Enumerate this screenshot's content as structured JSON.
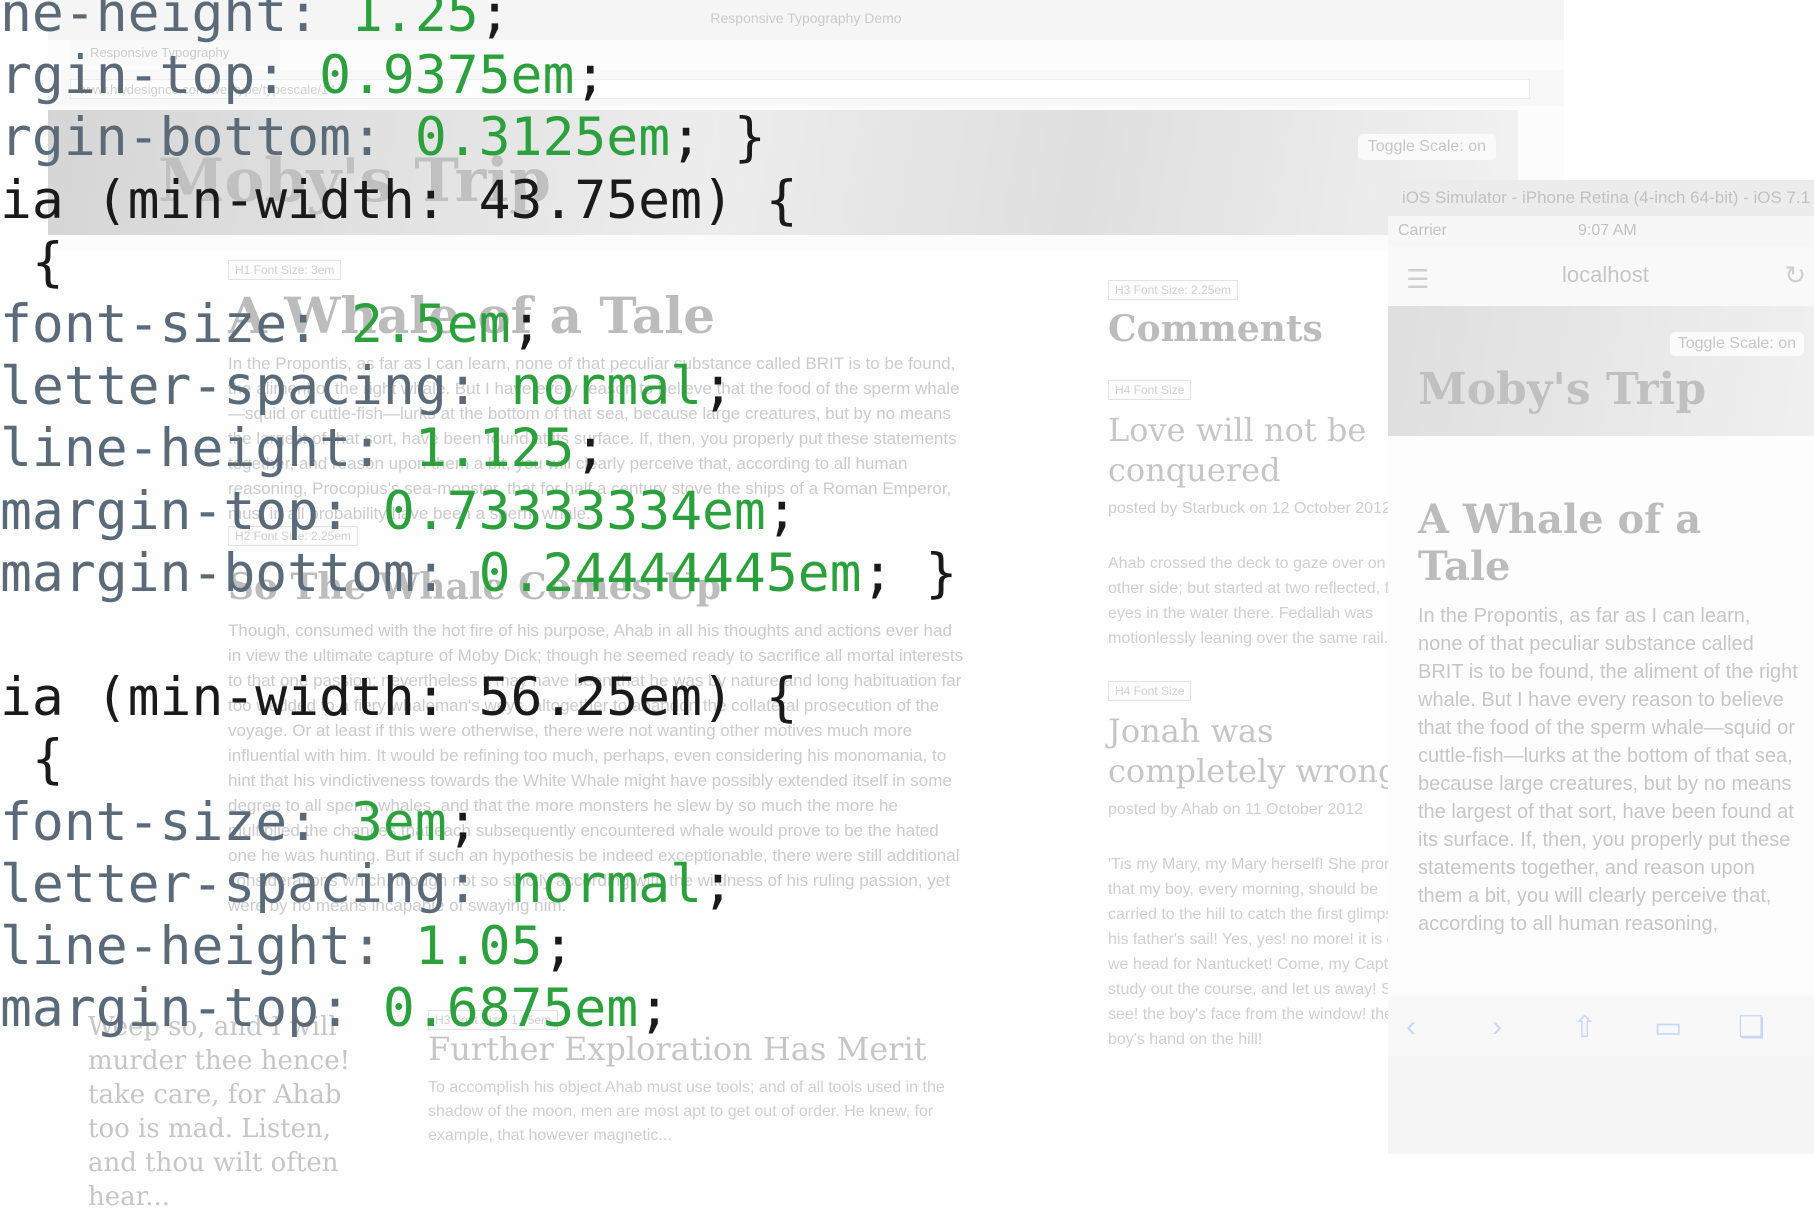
{
  "browser": {
    "window_title": "Responsive Typography Demo",
    "tab_label": "Responsive Typography",
    "url": "www.hwdesignco.com/webtype/typescale/14",
    "brand": "Moby's Trip",
    "toggle_label": "Toggle Scale: on"
  },
  "article": {
    "h1_badge": "H1 Font Size: 3em",
    "title": "A Whale of a Tale",
    "intro": "In the Propontis, as far as I can learn, none of that peculiar substance called BRIT is to be found, the aliment of the right whale. But I have every reason to believe that the food of the sperm whale—squid or cuttle-fish—lurks at the bottom of that sea, because large creatures, but by no means the largest of that sort, have been found at its surface. If, then, you properly put these statements together, and reason upon them a bit, you will clearly perceive that, according to all human reasoning, Procopius's sea-monster, that for half a century stove the ships of a Roman Emperor, must in all probability have been a sperm whale.",
    "h2_badge": "H2 Font Size: 2.25em",
    "h2": "So The Whale Comes Up",
    "body": "Though, consumed with the hot fire of his purpose, Ahab in all his thoughts and actions ever had in view the ultimate capture of Moby Dick; though he seemed ready to sacrifice all mortal interests to that one passion; nevertheless it may have been that he was by nature and long habituation far too wedded to a fiery whaleman's ways, altogether to abandon the collateral prosecution of the voyage. Or at least if this were otherwise, there were not wanting other motives much more influential with him. It would be refining too much, perhaps, even considering his monomania, to hint that his vindictiveness towards the White Whale might have possibly extended itself in some degree to all sperm whales, and that the more monsters he slew by so much the more he multiplied the chances that each subsequently encountered whale would prove to be the hated one he was hunting. But if such an hypothesis be indeed exceptionable, there were still additional considerations which, though not so strictly according with the wildness of his ruling passion, yet were by no means incapable of swaying him."
  },
  "comments": {
    "badge": "H3 Font Size: 2.25em",
    "title": "Comments",
    "items": [
      {
        "badge": "H4 Font Size",
        "title": "Love will not be conquered",
        "meta": "posted by Starbuck on 12 October 2012",
        "body": "Ahab crossed the deck to gaze over on the other side; but started at two reflected, fixed eyes in the water there. Fedallah was motionlessly leaning over the same rail."
      },
      {
        "badge": "H4 Font Size",
        "title": "Jonah was completely wrong",
        "meta": "posted by Ahab on 11 October 2012",
        "body": "'Tis my Mary, my Mary herself! She promised that my boy, every morning, should be carried to the hill to catch the first glimpse of his father's sail! Yes, yes! no more! it is done! we head for Nantucket! Come, my Captain, study out the course, and let us away! See, see! the boy's face from the window! the boy's hand on the hill!"
      }
    ]
  },
  "lower": {
    "quote": "Weep so, and I will murder thee hence! take care, for Ahab too is mad. Listen, and thou wilt often hear...",
    "h3_badge": "H3 Font Size: 1.75em",
    "h3": "Further Exploration Has Merit",
    "body": "To accomplish his object Ahab must use tools; and of all tools used in the shadow of the moon, men are most apt to get out of order. He knew, for example, that however magnetic..."
  },
  "simulator": {
    "title": "iOS Simulator - iPhone Retina (4-inch 64-bit) - iOS 7.1",
    "carrier": "Carrier",
    "time": "9:07 AM",
    "host": "localhost",
    "brand": "Moby's Trip",
    "toggle_label": "Toggle Scale: on",
    "article_title": "A Whale of a Tale",
    "article_body": "In the Propontis, as far as I can learn, none of that peculiar substance called BRIT is to be found, the aliment of the right whale. But I have every reason to believe that the food of the sperm whale—squid or cuttle-fish—lurks at the bottom of that sea, because large creatures, but by no means the largest of that sort, have been found at its surface. If, then, you properly put these statements together, and reason upon them a bit, you will clearly perceive that, according to all human reasoning,"
  },
  "code_lines": [
    {
      "property": "ne-height",
      "sep": ": ",
      "value": "1.25",
      "end": ";"
    },
    {
      "property": "rgin-top",
      "sep": ": ",
      "value": "0.9375em",
      "end": ";"
    },
    {
      "property": "rgin-bottom",
      "sep": ": ",
      "value": "0.3125em",
      "end": "; }"
    },
    {
      "property": "ia (min-width: 43.75em) {",
      "sep": "",
      "value": "",
      "end": ""
    },
    {
      "property": " {",
      "sep": "",
      "value": "",
      "end": ""
    },
    {
      "property": "font-size",
      "sep": ": ",
      "value": "2.5em",
      "end": ";"
    },
    {
      "property": "letter-spacing",
      "sep": ": ",
      "value": "normal",
      "end": ";"
    },
    {
      "property": "line-height",
      "sep": ": ",
      "value": "1.125",
      "end": ";"
    },
    {
      "property": "margin-top",
      "sep": ": ",
      "value": "0.73333334em",
      "end": ";"
    },
    {
      "property": "margin-bottom",
      "sep": ": ",
      "value": "0.24444445em",
      "end": "; }"
    },
    {
      "property": "",
      "sep": "",
      "value": "",
      "end": ""
    },
    {
      "property": "ia (min-width: 56.25em) {",
      "sep": "",
      "value": "",
      "end": ""
    },
    {
      "property": " {",
      "sep": "",
      "value": "",
      "end": ""
    },
    {
      "property": "font-size",
      "sep": ": ",
      "value": "3em",
      "end": ";"
    },
    {
      "property": "letter-spacing",
      "sep": ": ",
      "value": "normal",
      "end": ";"
    },
    {
      "property": "line-height",
      "sep": ": ",
      "value": "1.05",
      "end": ";"
    },
    {
      "property": "margin-top",
      "sep": ": ",
      "value": "0.6875em",
      "end": ";"
    }
  ]
}
